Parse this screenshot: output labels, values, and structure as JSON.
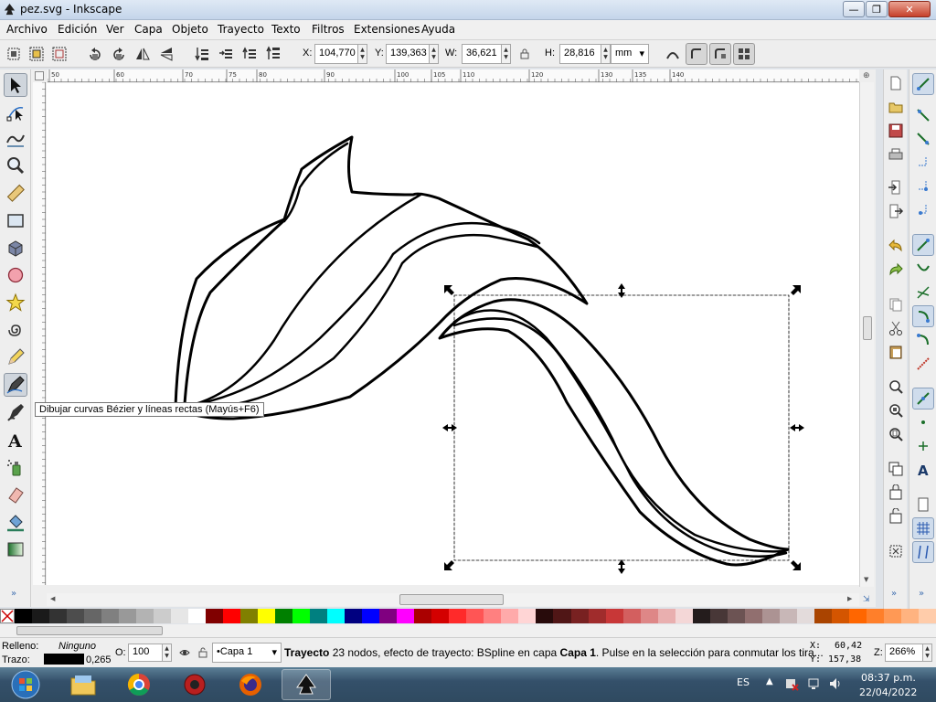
{
  "window": {
    "title": "pez.svg - Inkscape",
    "minimize": "—",
    "maximize": "❐",
    "close": "✕"
  },
  "menu": [
    "Archivo",
    "Edición",
    "Ver",
    "Capa",
    "Objeto",
    "Trayecto",
    "Texto",
    "Filtros",
    "Extensiones",
    "Ayuda"
  ],
  "controls": {
    "x_label": "X:",
    "x_value": "104,770",
    "y_label": "Y:",
    "y_value": "139,363",
    "w_label": "W:",
    "w_value": "36,621",
    "h_label": "H:",
    "h_value": "28,816",
    "unit": "mm"
  },
  "tooltip": "Dibujar curvas Bézier y líneas rectas (Mayús+F6)",
  "ruler": {
    "labels": [
      "50",
      "60",
      "70",
      "75",
      "80",
      "90",
      "100",
      "105",
      "110",
      "120",
      "130",
      "135",
      "140"
    ]
  },
  "canvas": {
    "shape_color": "#000000",
    "selection_color": "#000000"
  },
  "palette": [
    "#000000",
    "#1a1a1a",
    "#333333",
    "#4d4d4d",
    "#666666",
    "#808080",
    "#999999",
    "#b3b3b3",
    "#cccccc",
    "#e6e6e6",
    "#ffffff",
    "#800000",
    "#ff0000",
    "#808000",
    "#ffff00",
    "#008000",
    "#00ff00",
    "#008080",
    "#00ffff",
    "#000080",
    "#0000ff",
    "#800080",
    "#ff00ff",
    "#aa0000",
    "#d40000",
    "#ff2a2a",
    "#ff5555",
    "#ff8080",
    "#ffaaaa",
    "#ffd5d5",
    "#280b0b",
    "#501616",
    "#782121",
    "#a02c2c",
    "#c83737",
    "#d35f5f",
    "#de8787",
    "#e9afaf",
    "#f4d7d7",
    "#241c1c",
    "#483737",
    "#6c5353",
    "#916f6f",
    "#ac9393",
    "#c8b7b7",
    "#e3dbdb",
    "#aa4400",
    "#d45500",
    "#ff6600",
    "#ff7f2a",
    "#ff9955",
    "#ffb380",
    "#ffccaa"
  ],
  "status": {
    "fill_label": "Relleno:",
    "fill_value": "Ninguno",
    "stroke_label": "Trazo:",
    "stroke_width": "0,265",
    "opacity_label": "O:",
    "opacity_value": "100",
    "layer": "•Capa 1",
    "msg_type": "Trayecto",
    "msg_body": " 23 nodos, efecto de trayecto: BSpline en capa ",
    "msg_layer": "Capa 1",
    "msg_tail": ". Pulse en la selección para conmutar los tira...",
    "cx_label": "X:",
    "cx_value": "60,42",
    "cy_label": "Y:",
    "cy_value": "157,38",
    "zoom_label": "Z:",
    "zoom_value": "266%"
  },
  "taskbar": {
    "lang": "ES",
    "time": "08:37 p.m.",
    "date": "22/04/2022"
  }
}
